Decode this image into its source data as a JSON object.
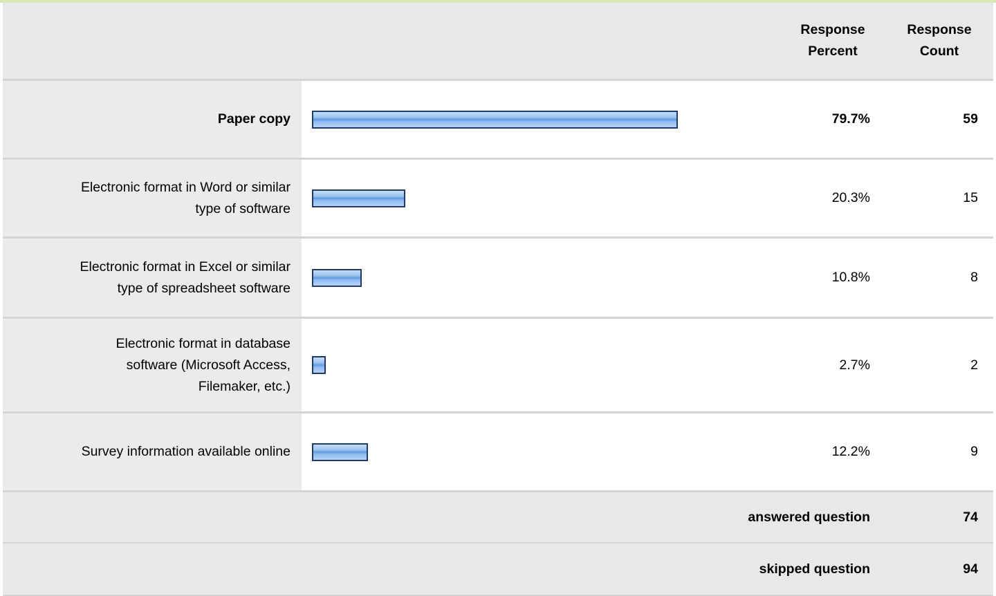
{
  "header": {
    "percent_label_1": "Response",
    "percent_label_2": "Percent",
    "count_label_1": "Response",
    "count_label_2": "Count"
  },
  "chart_data": {
    "type": "bar",
    "orientation": "horizontal",
    "categories": [
      "Paper copy",
      "Electronic format in Word or similar type of software",
      "Electronic format in Excel or similar type of spreadsheet software",
      "Electronic format in database software (Microsoft Access, Filemaker, etc.)",
      "Survey information available online"
    ],
    "values": [
      79.7,
      20.3,
      10.8,
      2.7,
      12.2
    ],
    "percent_labels": [
      "79.7%",
      "20.3%",
      "10.8%",
      "2.7%",
      "12.2%"
    ],
    "counts": [
      "59",
      "15",
      "8",
      "2",
      "9"
    ],
    "xlim": [
      0,
      100
    ]
  },
  "rows": [
    {
      "label_lines": [
        "Paper copy"
      ]
    },
    {
      "label_lines": [
        "Electronic format in Word or similar",
        "type of software"
      ]
    },
    {
      "label_lines": [
        "Electronic format in Excel or similar",
        "type of spreadsheet software"
      ]
    },
    {
      "label_lines": [
        "Electronic format in database",
        "software (Microsoft Access,",
        "Filemaker, etc.)"
      ]
    },
    {
      "label_lines": [
        "Survey information available online"
      ]
    }
  ],
  "summary": {
    "answered_label": "answered question",
    "answered_value": "74",
    "skipped_label": "skipped question",
    "skipped_value": "94"
  },
  "colors": {
    "bar_border": "#1f3a66",
    "bar_fill": "#8cbaf0",
    "header_bg": "#e8e8e8",
    "accent_line": "#d9e6b5"
  }
}
